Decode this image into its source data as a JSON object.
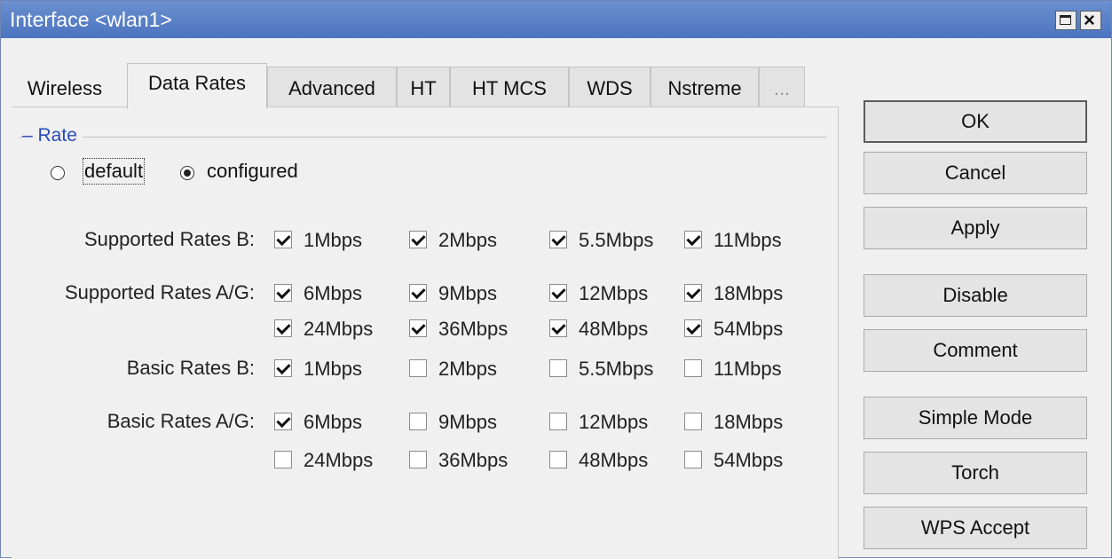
{
  "window": {
    "title": "Interface <wlan1>"
  },
  "tabs": [
    "Wireless",
    "Data Rates",
    "Advanced",
    "HT",
    "HT MCS",
    "WDS",
    "Nstreme",
    "..."
  ],
  "rate_group": {
    "legend": "Rate",
    "radio_default": "default",
    "radio_configured": "configured",
    "selected": "configured"
  },
  "rows": {
    "supported_b": {
      "label": "Supported Rates B:",
      "items": [
        {
          "label": "1Mbps",
          "checked": true
        },
        {
          "label": "2Mbps",
          "checked": true
        },
        {
          "label": "5.5Mbps",
          "checked": true
        },
        {
          "label": "11Mbps",
          "checked": true
        }
      ]
    },
    "supported_ag": {
      "label": "Supported Rates A/G:",
      "items": [
        {
          "label": "6Mbps",
          "checked": true
        },
        {
          "label": "9Mbps",
          "checked": true
        },
        {
          "label": "12Mbps",
          "checked": true
        },
        {
          "label": "18Mbps",
          "checked": true
        },
        {
          "label": "24Mbps",
          "checked": true
        },
        {
          "label": "36Mbps",
          "checked": true
        },
        {
          "label": "48Mbps",
          "checked": true
        },
        {
          "label": "54Mbps",
          "checked": true
        }
      ]
    },
    "basic_b": {
      "label": "Basic Rates B:",
      "items": [
        {
          "label": "1Mbps",
          "checked": true
        },
        {
          "label": "2Mbps",
          "checked": false
        },
        {
          "label": "5.5Mbps",
          "checked": false
        },
        {
          "label": "11Mbps",
          "checked": false
        }
      ]
    },
    "basic_ag": {
      "label": "Basic Rates A/G:",
      "items": [
        {
          "label": "6Mbps",
          "checked": true
        },
        {
          "label": "9Mbps",
          "checked": false
        },
        {
          "label": "12Mbps",
          "checked": false
        },
        {
          "label": "18Mbps",
          "checked": false
        },
        {
          "label": "24Mbps",
          "checked": false
        },
        {
          "label": "36Mbps",
          "checked": false
        },
        {
          "label": "48Mbps",
          "checked": false
        },
        {
          "label": "54Mbps",
          "checked": false
        }
      ]
    }
  },
  "buttons": {
    "ok": "OK",
    "cancel": "Cancel",
    "apply": "Apply",
    "disable": "Disable",
    "comment": "Comment",
    "simple_mode": "Simple Mode",
    "torch": "Torch",
    "wps_accept": "WPS Accept"
  },
  "colors": {
    "titlebar": "#5a80c8",
    "legend_text": "#2a4bb8",
    "window_bg": "#f0f0f0"
  }
}
